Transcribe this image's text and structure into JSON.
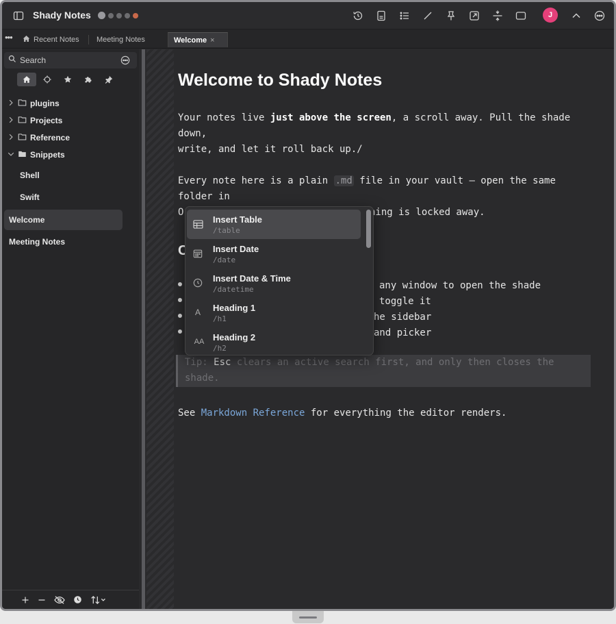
{
  "app": {
    "title": "Shady Notes"
  },
  "tabs": [
    {
      "label": "Recent Notes",
      "icon": "home-icon"
    },
    {
      "label": "Meeting Notes"
    },
    {
      "label": "Welcome",
      "active": true,
      "close": "×"
    }
  ],
  "sidebar": {
    "search_placeholder": "Search",
    "folders": [
      {
        "label": "plugins",
        "expanded": false
      },
      {
        "label": "Projects",
        "expanded": false
      },
      {
        "label": "Reference",
        "expanded": false
      },
      {
        "label": "Snippets",
        "expanded": true
      }
    ],
    "snippet_notes": [
      "Shell",
      "Swift"
    ],
    "notes": [
      {
        "label": "Welcome",
        "selected": true
      },
      {
        "label": "Meeting Notes"
      }
    ]
  },
  "editor": {
    "heading": "Welcome to Shady Notes",
    "p1_line1_pre": "Your notes live ",
    "p1_line1_bold": "just above the screen",
    "p1_line1_post": ", a scroll away. Pull the shade",
    "p1_line2": "down,",
    "p1_line3": "write, and let it roll back up./",
    "p2_line1_pre": "Every note here is a plain ",
    "p2_code": ".md",
    "p2_line1_post": " file in your vault — open the same",
    "p2_line2": "folder in",
    "p2_line3_start": "O",
    "p2_line3_end": "hing is locked away.",
    "h2_fragment": "C",
    "bullets": [
      "any window to open the shade",
      "toggle it",
      "he sidebar",
      "and picker"
    ],
    "tip_pre": "Tip: ",
    "tip_kbd": "Esc",
    "tip_post": " clears an active search first, and only then closes the",
    "tip_line2": "shade.",
    "final_pre": "See ",
    "final_link": "Markdown Reference",
    "final_post": " for everything the editor renders."
  },
  "slash_menu": {
    "items": [
      {
        "label": "Insert Table",
        "command": "/table",
        "icon": "table-icon",
        "selected": true
      },
      {
        "label": "Insert Date",
        "command": "/date",
        "icon": "calendar-icon"
      },
      {
        "label": "Insert Date & Time",
        "command": "/datetime",
        "icon": "clock-icon"
      },
      {
        "label": "Heading 1",
        "command": "/h1",
        "icon_text": "A"
      },
      {
        "label": "Heading 2",
        "command": "/h2",
        "icon_text": "AA"
      }
    ]
  },
  "user": {
    "initial": "J"
  },
  "colors": {
    "accent_avatar": "#e5407a",
    "link": "#7ba7d9",
    "background": "#2a2a2c"
  }
}
